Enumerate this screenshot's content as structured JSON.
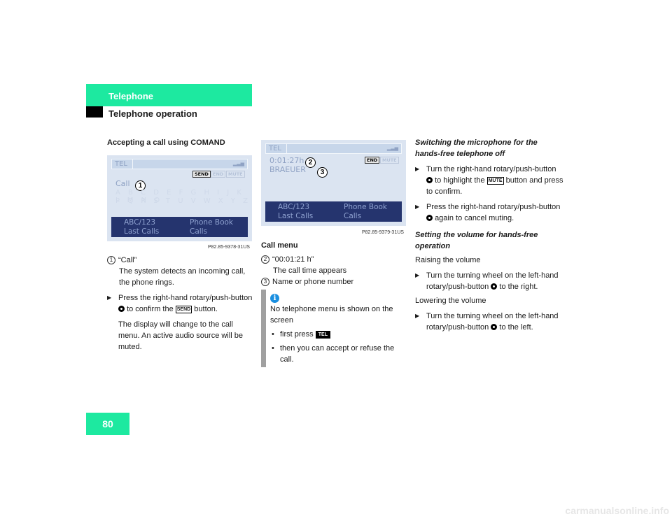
{
  "header": {
    "section": "Telephone",
    "subsection": "Telephone operation",
    "page_number": "80"
  },
  "col1": {
    "heading": "Accepting a call using COMAND",
    "screen": {
      "tel": "TEL",
      "send": "SEND",
      "end": "END",
      "mute": "MUTE",
      "call": "Call",
      "callout": "1",
      "alpha1": "A B C D E F G H I J K L M N O",
      "alpha2": "P Q R S T U V W X Y Z",
      "menu": [
        "ABC/123",
        "Phone Book",
        "Last Calls",
        "Calls"
      ]
    },
    "caption": "P82.85-9378-31US",
    "item1_num": "1",
    "item1_title": "“Call”",
    "item1_text": "The system detects an incoming call, the phone rings.",
    "step_a": "Press the right-hand rotary/push-button",
    "step_b": "to confirm the",
    "step_key": "SEND",
    "step_c": "button.",
    "note": "The display will change to the call menu. An active audio source will be muted."
  },
  "col2": {
    "screen": {
      "tel": "TEL",
      "time": "0:01:27h",
      "name": "BRAEUER",
      "end": "END",
      "mute": "MUTE",
      "callout2": "2",
      "callout3": "3",
      "menu": [
        "ABC/123",
        "Phone Book",
        "Last Calls",
        "Calls"
      ]
    },
    "caption": "P82.85-9379-31US",
    "heading": "Call menu",
    "item2_num": "2",
    "item2_title": "“00:01:21 h”",
    "item2_text": "The call time appears",
    "item3_num": "3",
    "item3_text": "Name or phone number",
    "info": {
      "icon": "info-icon",
      "text": "No telephone menu is shown on the screen",
      "b1": "first press",
      "b1_key": "TEL",
      "b2": "then you can accept or refuse the call."
    }
  },
  "col3": {
    "heading1": "Switching the microphone for the hands-free telephone off",
    "s1a": "Turn the right-hand rotary/push-button",
    "s1b": "to highlight the",
    "s1_key": "MUTE",
    "s1c": "button and press to confirm.",
    "s2a": "Press the right-hand rotary/push-button",
    "s2b": "again to cancel muting.",
    "heading2": "Setting the volume for hands-free operation",
    "raise": "Raising the volume",
    "s3a": "Turn the turning wheel on the left-hand rotary/push-button",
    "s3b": "to the right.",
    "lower": "Lowering the volume",
    "s4a": "Turn the turning wheel on the left-hand rotary/push-button",
    "s4b": "to the left."
  },
  "watermark": "carmanualsonline.info",
  "colors": {
    "accent": "#1de9a0",
    "screen_bg": "#dbe4f1",
    "menu_bg": "#25346e"
  }
}
